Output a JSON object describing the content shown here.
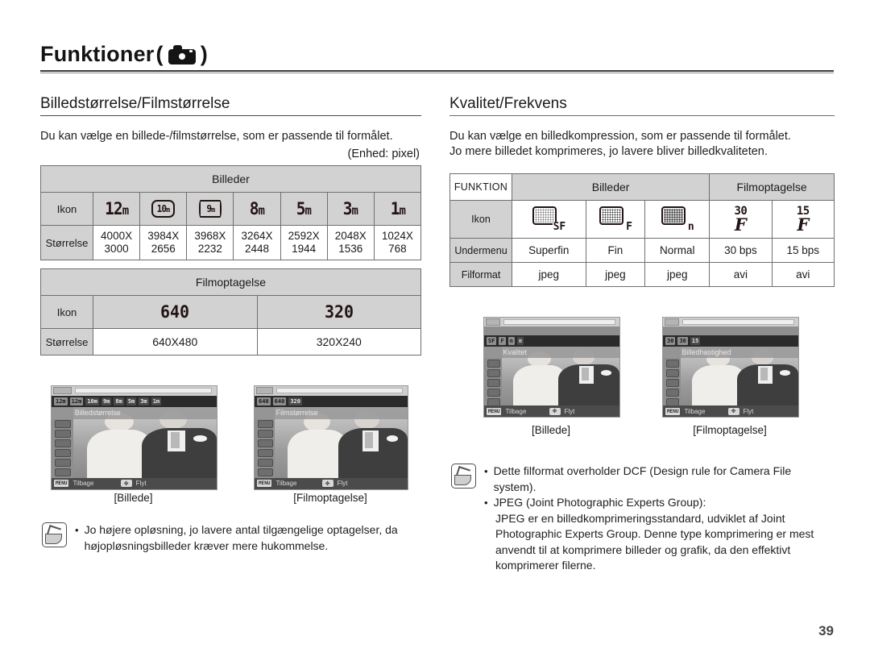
{
  "header": {
    "title": "Funktioner",
    "icon": "camera-icon",
    "paren_open": "(",
    "paren_close": ")"
  },
  "left": {
    "section_title": "Billedstørrelse/Filmstørrelse",
    "intro": "Du kan vælge en billede-/filmstørrelse, som er passende til formålet.",
    "unit": "(Enhed: pixel)",
    "stills_table": {
      "group_header": "Billeder",
      "row_labels": {
        "icon": "Ikon",
        "size": "Størrelse"
      },
      "columns": [
        {
          "icon_text": "12",
          "icon_suffix": "m",
          "icon_style": "plain",
          "size_line1": "4000X",
          "size_line2": "3000"
        },
        {
          "icon_text": "10",
          "icon_suffix": "m",
          "icon_style": "boxed",
          "size_line1": "3984X",
          "size_line2": "2656"
        },
        {
          "icon_text": "9",
          "icon_suffix": "m",
          "icon_style": "pano",
          "size_line1": "3968X",
          "size_line2": "2232"
        },
        {
          "icon_text": "8",
          "icon_suffix": "m",
          "icon_style": "plain",
          "size_line1": "3264X",
          "size_line2": "2448"
        },
        {
          "icon_text": "5",
          "icon_suffix": "m",
          "icon_style": "plain",
          "size_line1": "2592X",
          "size_line2": "1944"
        },
        {
          "icon_text": "3",
          "icon_suffix": "m",
          "icon_style": "plain",
          "size_line1": "2048X",
          "size_line2": "1536"
        },
        {
          "icon_text": "1",
          "icon_suffix": "m",
          "icon_style": "plain",
          "size_line1": "1024X",
          "size_line2": "768"
        }
      ]
    },
    "movie_table": {
      "group_header": "Filmoptagelse",
      "row_labels": {
        "icon": "Ikon",
        "size": "Størrelse"
      },
      "columns": [
        {
          "icon_text": "640",
          "size": "640X480"
        },
        {
          "icon_text": "320",
          "size": "320X240"
        }
      ]
    },
    "screenshots": [
      {
        "menu_title": "Billedstørrelse",
        "options": [
          "12m",
          "12m",
          "10m",
          "9m",
          "8m",
          "5m",
          "3m",
          "1m"
        ],
        "selected_index": 1,
        "back_key": "MENU",
        "back_label": "Tilbage",
        "move_key": "pad-icon",
        "move_label": "Flyt",
        "caption": "[Billede]"
      },
      {
        "menu_title": "Filmstørrelse",
        "options": [
          "640",
          "640",
          "320"
        ],
        "selected_index": 1,
        "back_key": "MENU",
        "back_label": "Tilbage",
        "move_key": "pad-icon",
        "move_label": "Flyt",
        "caption": "[Filmoptagelse]"
      }
    ],
    "note": {
      "items": [
        {
          "bullet": "•",
          "text": "Jo højere opløsning, jo lavere antal tilgængelige optagelser, da højopløsningsbilleder kræver mere hukommelse."
        }
      ]
    }
  },
  "right": {
    "section_title": "Kvalitet/Frekvens",
    "intro_line1": "Du kan vælge en billedkompression, som er passende til formålet.",
    "intro_line2": "Jo mere billedet komprimeres, jo lavere bliver billedkvaliteten.",
    "quality_table": {
      "corner_label": "FUNKTION",
      "group_stills": "Billeder",
      "group_movie": "Filmoptagelse",
      "row_labels": {
        "icon": "Ikon",
        "submenu": "Undermenu",
        "format": "Filformat"
      },
      "columns": [
        {
          "icon_kind": "quality",
          "icon_letter": "SF",
          "icon_density": "sf",
          "submenu": "Superfin",
          "format": "jpeg"
        },
        {
          "icon_kind": "quality",
          "icon_letter": "F",
          "icon_density": "f",
          "submenu": "Fin",
          "format": "jpeg"
        },
        {
          "icon_kind": "quality",
          "icon_letter": "n",
          "icon_density": "n",
          "submenu": "Normal",
          "format": "jpeg"
        },
        {
          "icon_kind": "fps",
          "icon_number": "30",
          "submenu": "30 bps",
          "format": "avi"
        },
        {
          "icon_kind": "fps",
          "icon_number": "15",
          "submenu": "15 bps",
          "format": "avi"
        }
      ]
    },
    "screenshots": [
      {
        "menu_title": "Kvalitet",
        "options": [
          "SF",
          "F",
          "n",
          "n"
        ],
        "selected_index": 2,
        "back_key": "MENU",
        "back_label": "Tilbage",
        "move_key": "pad-icon",
        "move_label": "Flyt",
        "caption": "[Billede]"
      },
      {
        "menu_title": "Billedhastighed",
        "options": [
          "30",
          "30",
          "15"
        ],
        "selected_index": 1,
        "back_key": "MENU",
        "back_label": "Tilbage",
        "move_key": "pad-icon",
        "move_label": "Flyt",
        "caption": "[Filmoptagelse]"
      }
    ],
    "note": {
      "items": [
        {
          "bullet": "•",
          "text": "Dette filformat overholder DCF (Design rule for Camera File system)."
        },
        {
          "bullet": "•",
          "text": "JPEG (Joint Photographic Experts Group):"
        }
      ],
      "sub_text": "JPEG er en billedkomprimeringsstandard, udviklet af Joint Photographic Experts Group. Denne type komprimering er mest anvendt til at komprimere billeder og grafik, da den effektivt komprimerer filerne."
    }
  },
  "footer": {
    "page_number": "39"
  }
}
